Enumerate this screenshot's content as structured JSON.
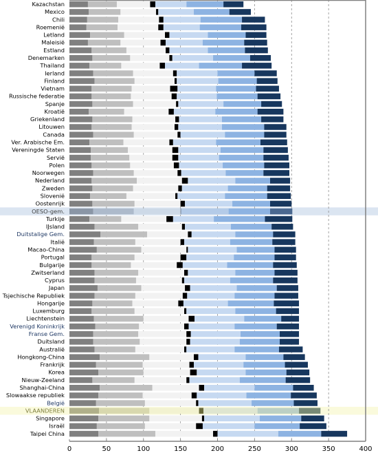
{
  "chart_data": {
    "type": "bar",
    "subtype": "stacked-percentile-bar",
    "title": "",
    "xlabel": "",
    "ylabel": "",
    "xlim": [
      0,
      400
    ],
    "xticks": [
      "0",
      "50",
      "100",
      "150",
      "200",
      "250",
      "300",
      "350",
      "400"
    ],
    "grid": "vertical-dashed",
    "legend": "none",
    "segments": [
      "p5-p10",
      "p10-p25",
      "p25-mean_ci_low",
      "mean_ci",
      "mean_ci_high-p75",
      "p75-p90",
      "p90-p95"
    ],
    "colors": {
      "seg1": "#808080",
      "seg2": "#bfbfbf",
      "seg3": "#f2f2f2",
      "mean": "#000000",
      "seg5": "#c6d9f1",
      "seg6": "#8db3e2",
      "seg7": "#17375e",
      "highlight_oeso": "#dbe5f1",
      "highlight_vlaanderen": "#fafadc",
      "label_default": "#000000",
      "label_belgian": "#1f3864",
      "label_vlaanderen": "#7f7f3f",
      "label_oeso": "#404040"
    },
    "rows": [
      {
        "label": "Kazachstan",
        "b": [
          25,
          64,
          109,
          116,
          158,
          208,
          235
        ]
      },
      {
        "label": "Mexico",
        "b": [
          26,
          69,
          117,
          120,
          168,
          216,
          245
        ]
      },
      {
        "label": "Chili",
        "b": [
          24,
          66,
          121,
          127,
          177,
          233,
          264
        ]
      },
      {
        "label": "Roemenië",
        "b": [
          23,
          65,
          120,
          127,
          176,
          232,
          266
        ]
      },
      {
        "label": "Letland",
        "b": [
          28,
          74,
          129,
          135,
          187,
          238,
          266
        ]
      },
      {
        "label": "Maleisië",
        "b": [
          25,
          69,
          123,
          130,
          180,
          236,
          267
        ]
      },
      {
        "label": "Estland",
        "b": [
          30,
          77,
          130,
          135,
          187,
          237,
          268
        ]
      },
      {
        "label": "Denemarken",
        "b": [
          31,
          82,
          135,
          139,
          194,
          244,
          272
        ]
      },
      {
        "label": "Thailand",
        "b": [
          27,
          70,
          122,
          129,
          175,
          233,
          273
        ]
      },
      {
        "label": "Ierland",
        "b": [
          32,
          86,
          140,
          145,
          200,
          250,
          280
        ]
      },
      {
        "label": "Finland",
        "b": [
          34,
          88,
          142,
          145,
          201,
          253,
          281
        ]
      },
      {
        "label": "Vietnam",
        "b": [
          30,
          84,
          136,
          146,
          198,
          252,
          283
        ]
      },
      {
        "label": "Russische federatie",
        "b": [
          30,
          83,
          138,
          145,
          199,
          254,
          285
        ]
      },
      {
        "label": "Spanje",
        "b": [
          31,
          86,
          144,
          147,
          208,
          259,
          287
        ]
      },
      {
        "label": "Kroatië",
        "b": [
          26,
          74,
          134,
          141,
          197,
          254,
          289
        ]
      },
      {
        "label": "Griekenland",
        "b": [
          31,
          85,
          143,
          148,
          206,
          259,
          289
        ]
      },
      {
        "label": "Litouwen",
        "b": [
          30,
          84,
          142,
          147,
          206,
          263,
          293
        ]
      },
      {
        "label": "Canada",
        "b": [
          32,
          87,
          146,
          150,
          210,
          263,
          293
        ]
      },
      {
        "label": "Ver. Arabische Em.",
        "b": [
          27,
          73,
          135,
          140,
          198,
          258,
          294
        ]
      },
      {
        "label": "Vereningde Staten",
        "b": [
          29,
          79,
          139,
          147,
          204,
          262,
          295
        ]
      },
      {
        "label": "Servië",
        "b": [
          29,
          81,
          139,
          147,
          202,
          262,
          296
        ]
      },
      {
        "label": "Polen",
        "b": [
          30,
          82,
          141,
          148,
          207,
          263,
          297
        ]
      },
      {
        "label": "Noorwegen",
        "b": [
          32,
          87,
          146,
          151,
          211,
          262,
          297
        ]
      },
      {
        "label": "Nederland",
        "b": [
          30,
          91,
          152,
          160,
          224,
          271,
          298
        ]
      },
      {
        "label": "Zweden",
        "b": [
          31,
          86,
          147,
          152,
          214,
          267,
          298
        ]
      },
      {
        "label": "Slovenië",
        "b": [
          28,
          77,
          143,
          146,
          210,
          267,
          299
        ]
      },
      {
        "label": "Oostenrijk",
        "b": [
          31,
          88,
          150,
          156,
          220,
          271,
          300
        ]
      },
      {
        "label": "OESO-gem.",
        "b": [
          32,
          87,
          150,
          151,
          215,
          271,
          301
        ],
        "style": "oeso"
      },
      {
        "label": "Turkije",
        "b": [
          27,
          70,
          131,
          140,
          195,
          264,
          301
        ]
      },
      {
        "label": "IJsland",
        "b": [
          34,
          93,
          152,
          156,
          218,
          273,
          302
        ]
      },
      {
        "label": "Duitstalige Gem.",
        "b": [
          42,
          105,
          160,
          165,
          224,
          275,
          305
        ],
        "style": "belgian"
      },
      {
        "label": "Italië",
        "b": [
          33,
          89,
          150,
          155,
          217,
          274,
          305
        ]
      },
      {
        "label": "Macao-China",
        "b": [
          37,
          97,
          158,
          160,
          226,
          277,
          306
        ]
      },
      {
        "label": "Portugal",
        "b": [
          30,
          88,
          150,
          158,
          222,
          277,
          306
        ]
      },
      {
        "label": "Bulgarije",
        "b": [
          30,
          83,
          145,
          153,
          213,
          275,
          307
        ]
      },
      {
        "label": "Zwitserland",
        "b": [
          34,
          93,
          155,
          160,
          224,
          277,
          308
        ]
      },
      {
        "label": "Cyprus",
        "b": [
          34,
          90,
          152,
          155,
          217,
          275,
          308
        ]
      },
      {
        "label": "Japan",
        "b": [
          38,
          97,
          156,
          163,
          226,
          280,
          309
        ]
      },
      {
        "label": "Tsjechische Republiek",
        "b": [
          34,
          89,
          153,
          159,
          223,
          277,
          309
        ]
      },
      {
        "label": "Hongarije",
        "b": [
          31,
          85,
          147,
          154,
          214,
          276,
          310
        ]
      },
      {
        "label": "Luxemburg",
        "b": [
          30,
          88,
          155,
          158,
          224,
          279,
          310
        ]
      },
      {
        "label": "Liechtenstein",
        "b": [
          33,
          100,
          161,
          169,
          236,
          286,
          310
        ]
      },
      {
        "label": "Verenigd Koninkrijk",
        "b": [
          35,
          94,
          155,
          161,
          223,
          280,
          310
        ],
        "style": "belgian"
      },
      {
        "label": "Franse Gem.",
        "b": [
          32,
          93,
          158,
          164,
          231,
          284,
          310
        ],
        "style": "belgian"
      },
      {
        "label": "Duitsland",
        "b": [
          32,
          95,
          158,
          163,
          230,
          284,
          310
        ]
      },
      {
        "label": "Australië",
        "b": [
          34,
          89,
          155,
          158,
          223,
          283,
          315
        ]
      },
      {
        "label": "Hongkong-China",
        "b": [
          41,
          108,
          168,
          174,
          238,
          289,
          318
        ]
      },
      {
        "label": "Frankrijk",
        "b": [
          36,
          99,
          162,
          168,
          235,
          291,
          322
        ]
      },
      {
        "label": "Korea",
        "b": [
          39,
          100,
          163,
          172,
          238,
          293,
          324
        ]
      },
      {
        "label": "Nieuw-Zeeland",
        "b": [
          31,
          88,
          158,
          162,
          230,
          292,
          325
        ]
      },
      {
        "label": "Shanghai-China",
        "b": [
          41,
          112,
          175,
          182,
          250,
          302,
          330
        ]
      },
      {
        "label": "Slowaakse republiek",
        "b": [
          39,
          99,
          165,
          172,
          239,
          299,
          334
        ]
      },
      {
        "label": "België",
        "b": [
          36,
          102,
          171,
          174,
          246,
          303,
          335
        ],
        "style": "belgian"
      },
      {
        "label": "VLAANDEREN",
        "b": [
          40,
          108,
          175,
          181,
          254,
          310,
          339
        ],
        "style": "vlaanderen"
      },
      {
        "label": "Singapore",
        "b": [
          39,
          108,
          179,
          182,
          257,
          313,
          344
        ]
      },
      {
        "label": "Israël",
        "b": [
          37,
          102,
          171,
          180,
          250,
          311,
          347
        ]
      },
      {
        "label": "Taipei China",
        "b": [
          39,
          116,
          194,
          200,
          282,
          340,
          375
        ]
      }
    ]
  }
}
